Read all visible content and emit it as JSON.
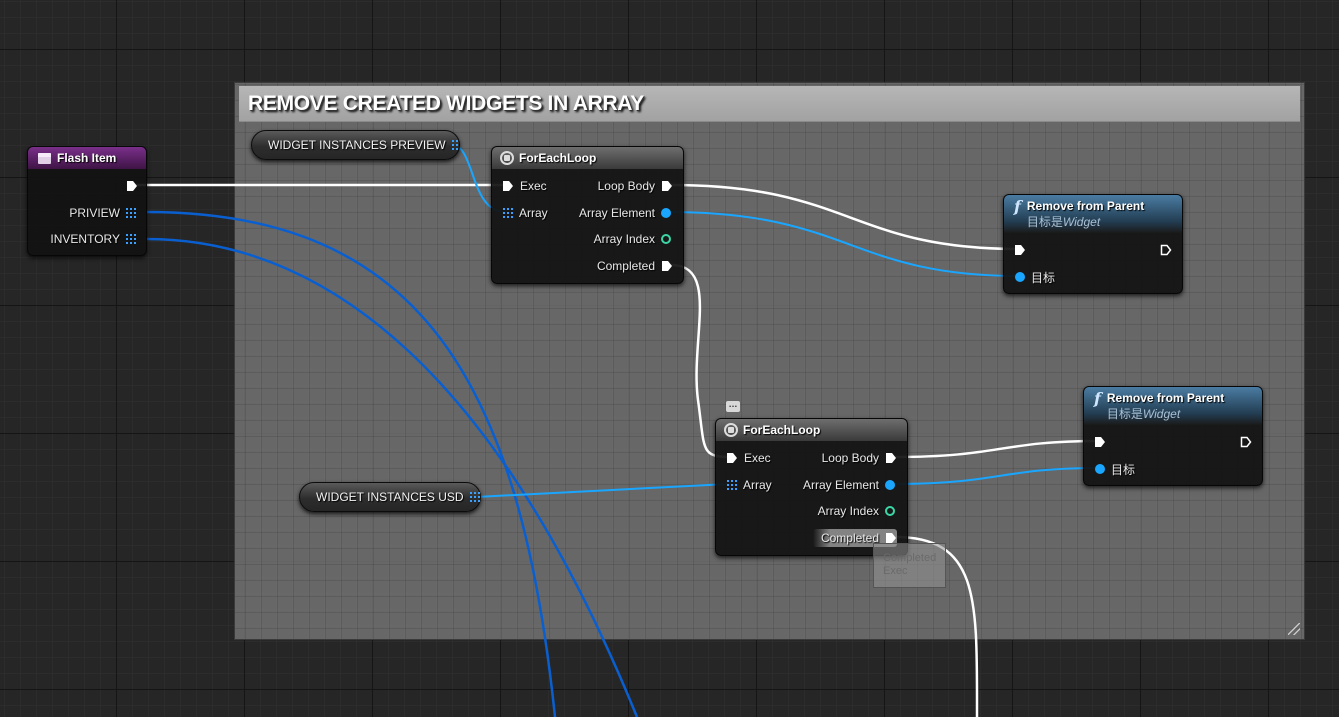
{
  "comment": {
    "title": "REMOVE CREATED WIDGETS IN ARRAY"
  },
  "flash_item": {
    "title": "Flash Item",
    "outputs": [
      "PRIVIEW",
      "INVENTORY"
    ]
  },
  "var_preview": {
    "label": "WIDGET INSTANCES PREVIEW"
  },
  "var_usd": {
    "label": "WIDGET INSTANCES USD"
  },
  "foreach1": {
    "title": "ForEachLoop",
    "inputs": [
      "Exec",
      "Array"
    ],
    "outputs": [
      "Loop Body",
      "Array Element",
      "Array Index",
      "Completed"
    ]
  },
  "foreach2": {
    "title": "ForEachLoop",
    "inputs": [
      "Exec",
      "Array"
    ],
    "outputs": [
      "Loop Body",
      "Array Element",
      "Array Index",
      "Completed"
    ]
  },
  "remove1": {
    "title": "Remove from Parent",
    "subtitle_prefix": "目标是",
    "subtitle_type": "Widget",
    "target_label": "目标"
  },
  "remove2": {
    "title": "Remove from Parent",
    "subtitle_prefix": "目标是",
    "subtitle_type": "Widget",
    "target_label": "目标"
  },
  "tooltip": {
    "line1": "Completed",
    "line2": "Exec"
  },
  "colors": {
    "exec": "#ffffff",
    "object_pin": "#1aa6ff",
    "index_pin": "#3cd6a6",
    "array_wire": "#0a5fd0",
    "function_header": "#3d6a8c",
    "event_header": "#6c2a78"
  }
}
